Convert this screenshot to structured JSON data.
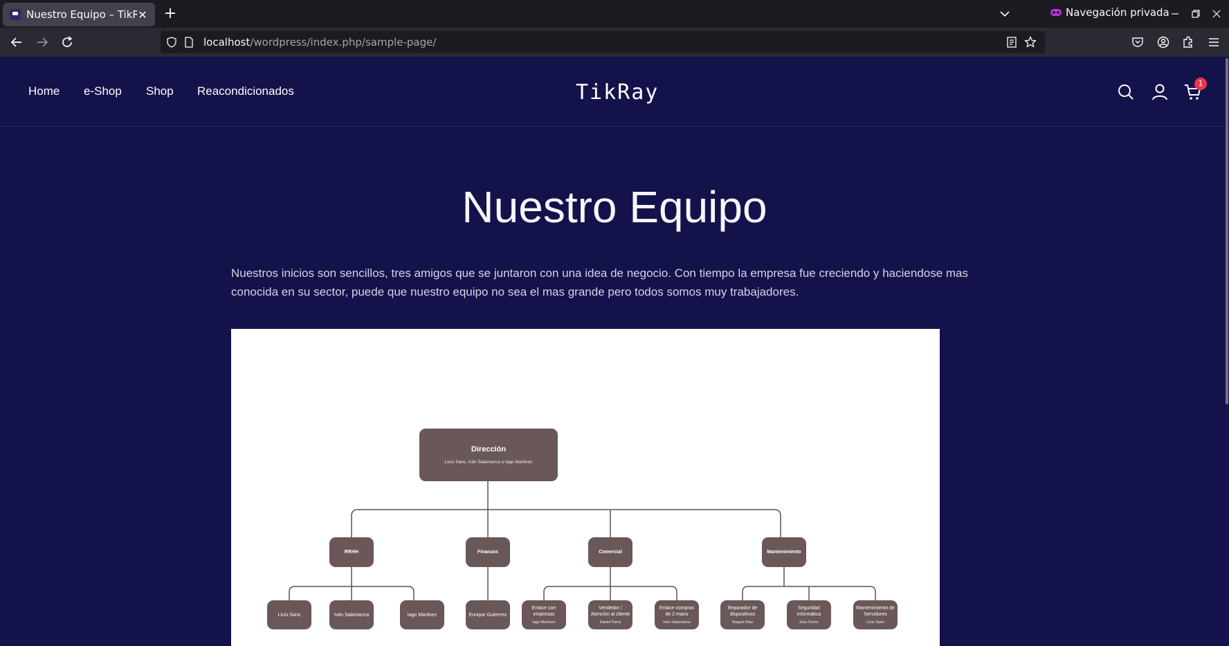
{
  "browser": {
    "tab_title": "Nuestro Equipo – TikRay",
    "tab_close": "✕",
    "new_tab": "+",
    "private_label": "Navegación privada",
    "url_host": "localhost",
    "url_path": "/wordpress/index.php/sample-page/"
  },
  "site": {
    "menu": [
      "Home",
      "e-Shop",
      "Shop",
      "Reacondicionados"
    ],
    "logo": "TikRay",
    "cart_count": "1"
  },
  "page": {
    "title": "Nuestro Equipo",
    "intro": "Nuestros inicios son sencillos, tres amigos que se juntaron con una idea de negocio. Con tiempo la empresa fue creciendo y haciendose mas conocida en su sector, puede que nuestro equipo no sea el mas grande pero todos somos muy trabajadores."
  },
  "org_chart": {
    "root": {
      "title": "Dirección",
      "subtitle": "Lluís Sans, Iván Salamanca y Iago Martinez"
    },
    "departments": [
      {
        "title": "RRHH",
        "members": [
          {
            "text": "Lluís Sans"
          },
          {
            "text": "Iván Salamanca"
          },
          {
            "text": "Iago Martinez"
          }
        ]
      },
      {
        "title": "Finanzas",
        "members": [
          {
            "text": "Enrique Gutierrez"
          }
        ]
      },
      {
        "title": "Comercial",
        "members": [
          {
            "text": "Enlace con empresas",
            "person": "Iago Martinez"
          },
          {
            "text": "Vendedor / Atención al cliente",
            "person": "Daniel Parra"
          },
          {
            "text": "Enlace compras de 2 mano",
            "person": "Iván Salamanca"
          }
        ]
      },
      {
        "title": "Mantenimiento",
        "members": [
          {
            "text": "Reparador de dispositivos",
            "person": "Raquel Díaz"
          },
          {
            "text": "Seguridad informática",
            "person": "Elsa Torres"
          },
          {
            "text": "Mantenimiento de Servidores",
            "person": "Lluís Sans"
          }
        ]
      }
    ]
  }
}
